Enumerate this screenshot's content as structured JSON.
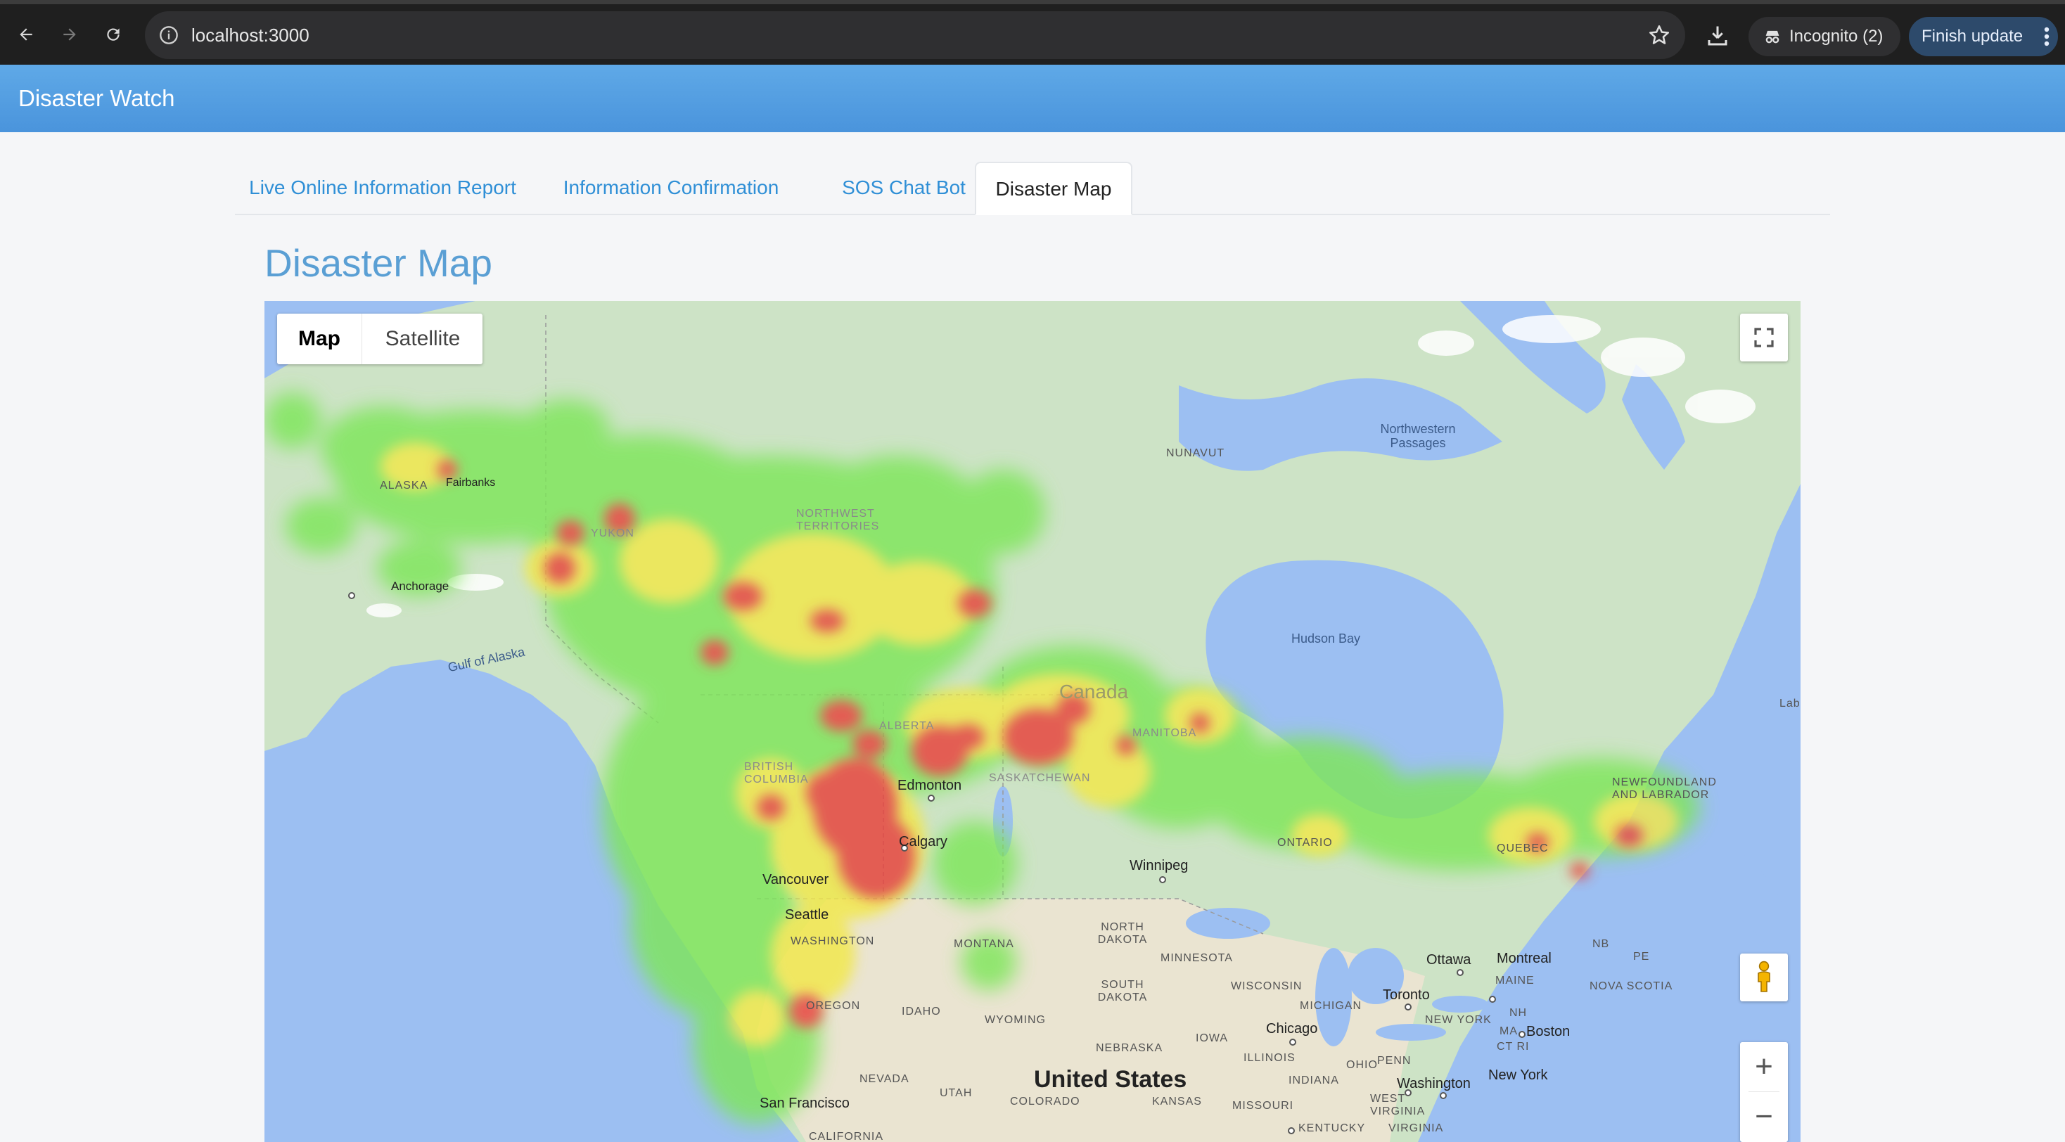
{
  "browser": {
    "url": "localhost:3000",
    "incognito_label": "Incognito (2)",
    "finish_update_label": "Finish update"
  },
  "app": {
    "title": "Disaster Watch"
  },
  "tabs": [
    {
      "label": "Live Online Information Report",
      "active": false
    },
    {
      "label": "Information Confirmation",
      "active": false
    },
    {
      "label": "SOS Chat Bot",
      "active": false
    },
    {
      "label": "Disaster Map",
      "active": true
    }
  ],
  "page": {
    "title": "Disaster Map"
  },
  "map": {
    "type_controls": {
      "map": "Map",
      "satellite": "Satellite",
      "selected": "Map"
    },
    "zoom_in": "+",
    "zoom_out": "−",
    "labels": {
      "alaska": "ALASKA",
      "fairbanks": "Fairbanks",
      "anchorage": "Anchorage",
      "gulf_of_alaska": "Gulf of Alaska",
      "yukon": "YUKON",
      "nwt": "NORTHWEST TERRITORIES",
      "nunavut": "NUNAVUT",
      "northwestern_passages": "Northwestern Passages",
      "hudson_bay": "Hudson Bay",
      "canada": "Canada",
      "alberta": "ALBERTA",
      "bc": "BRITISH COLUMBIA",
      "saskatchewan": "SASKATCHEWAN",
      "manitoba": "MANITOBA",
      "ontario": "ONTARIO",
      "quebec": "QUEBEC",
      "newfoundland": "NEWFOUNDLAND AND LABRADOR",
      "edmonton": "Edmonton",
      "calgary": "Calgary",
      "vancouver": "Vancouver",
      "seattle": "Seattle",
      "winnipeg": "Winnipeg",
      "washington": "WASHINGTON",
      "oregon": "OREGON",
      "idaho": "IDAHO",
      "montana": "MONTANA",
      "wyoming": "WYOMING",
      "nevada": "NEVADA",
      "utah": "UTAH",
      "colorado": "COLORADO",
      "california": "CALIFORNIA",
      "north_dakota": "NORTH DAKOTA",
      "south_dakota": "SOUTH DAKOTA",
      "nebraska": "NEBRASKA",
      "kansas": "KANSAS",
      "minnesota": "MINNESOTA",
      "wisconsin": "WISCONSIN",
      "michigan": "MICHIGAN",
      "iowa": "IOWA",
      "illinois": "ILLINOIS",
      "missouri": "MISSOURI",
      "indiana": "INDIANA",
      "ohio": "OHIO",
      "kentucky": "KENTUCKY",
      "west_virginia": "WEST VIRGINIA",
      "virginia": "VIRGINIA",
      "penn": "PENN",
      "new_york_state": "NEW YORK",
      "maine": "MAINE",
      "nh": "NH",
      "ma": "MA",
      "ct_ri": "CT RI",
      "nb": "NB",
      "pe": "PE",
      "nova_scotia": "NOVA SCOTIA",
      "united_states": "United States",
      "san_francisco": "San Francisco",
      "chicago": "Chicago",
      "toronto": "Toronto",
      "ottawa": "Ottawa",
      "montreal": "Montreal",
      "boston": "Boston",
      "new_york": "New York",
      "washington_dc": "Washington",
      "lab": "Lab"
    },
    "colors": {
      "water": "#9cbff2",
      "land": "#cde3c6",
      "heat_low": "#7ee65a",
      "heat_mid": "#f2e84a",
      "heat_high": "#e8403a"
    }
  }
}
